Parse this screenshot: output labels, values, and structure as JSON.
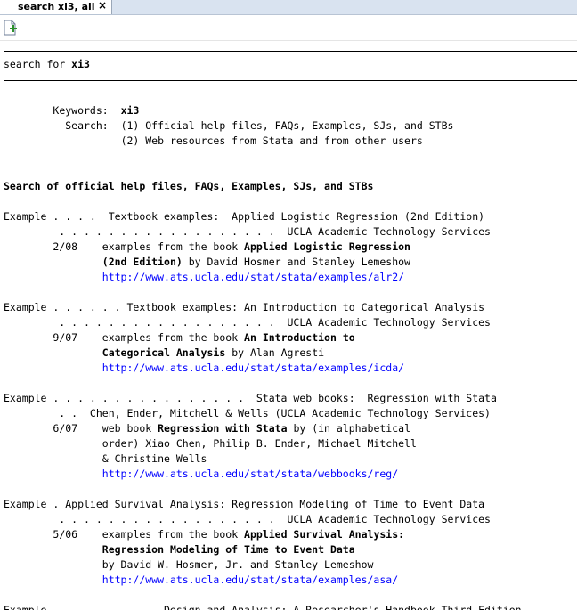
{
  "tab": {
    "title": "search xi3, all",
    "close_symbol": "×"
  },
  "toolbar": {
    "new_icon": "new-document-icon"
  },
  "header": {
    "search_prefix": "search for ",
    "search_term": "xi3"
  },
  "keywords": {
    "keywords_label": "Keywords:  ",
    "keywords_value": "xi3",
    "search_label": "Search:  ",
    "scope_1": "(1) Official help files, FAQs, Examples, SJs, and STBs",
    "scope_2": "(2) Web resources from Stata and from other users"
  },
  "section_heading": "Search of official help files, FAQs, Examples, SJs, and STBs",
  "entries": [
    {
      "row1": "Example . . . .  Textbook examples:  Applied Logistic Regression (2nd Edition)",
      "row2": "         . . . . . . . . . . . . . . . . . .  UCLA Academic Technology Services",
      "date": "2/08",
      "l1_pre": "examples from the book ",
      "l1_bold": "Applied Logistic Regression",
      "l2_bold": "(2nd Edition)",
      "l2_rest": " by David Hosmer and Stanley Lemeshow",
      "url": "http://www.ats.ucla.edu/stat/stata/examples/alr2/"
    },
    {
      "row1": "Example . . . . . . Textbook examples: An Introduction to Categorical Analysis",
      "row2": "         . . . . . . . . . . . . . . . . . .  UCLA Academic Technology Services",
      "date": "9/07",
      "l1_pre": "examples from the book ",
      "l1_bold": "An Introduction to",
      "l2_bold": "Categorical Analysis",
      "l2_rest": " by Alan Agresti",
      "url": "http://www.ats.ucla.edu/stat/stata/examples/icda/"
    },
    {
      "row1": "Example . . . . . . . . . . . . . . . .  Stata web books:  Regression with Stata",
      "row2": "         . .  Chen, Ender, Mitchell & Wells (UCLA Academic Technology Services)",
      "date": "6/07",
      "l1_pre": "web book ",
      "l1_bold": "Regression with Stata",
      "l1_post": " by (in alphabetical",
      "l2": "order) Xiao Chen, Philip B. Ender, Michael Mitchell",
      "l3": "& Christine Wells",
      "url": "http://www.ats.ucla.edu/stat/stata/webbooks/reg/"
    },
    {
      "row1": "Example . Applied Survival Analysis: Regression Modeling of Time to Event Data",
      "row2": "         . . . . . . . . . . . . . . . . . .  UCLA Academic Technology Services",
      "date": "5/06",
      "l1_pre": "examples from the book ",
      "l1_bold": "Applied Survival Analysis:",
      "l2_bold": "Regression Modeling of Time to Event Data",
      "l3": "by David W. Hosmer, Jr. and Stanley Lemeshow",
      "url": "http://www.ats.ucla.edu/stat/stata/examples/asa/"
    }
  ],
  "cutoff_row": "Example . . . . . . . . . Design and Analysis: A Researcher's Handbook Third Edition"
}
